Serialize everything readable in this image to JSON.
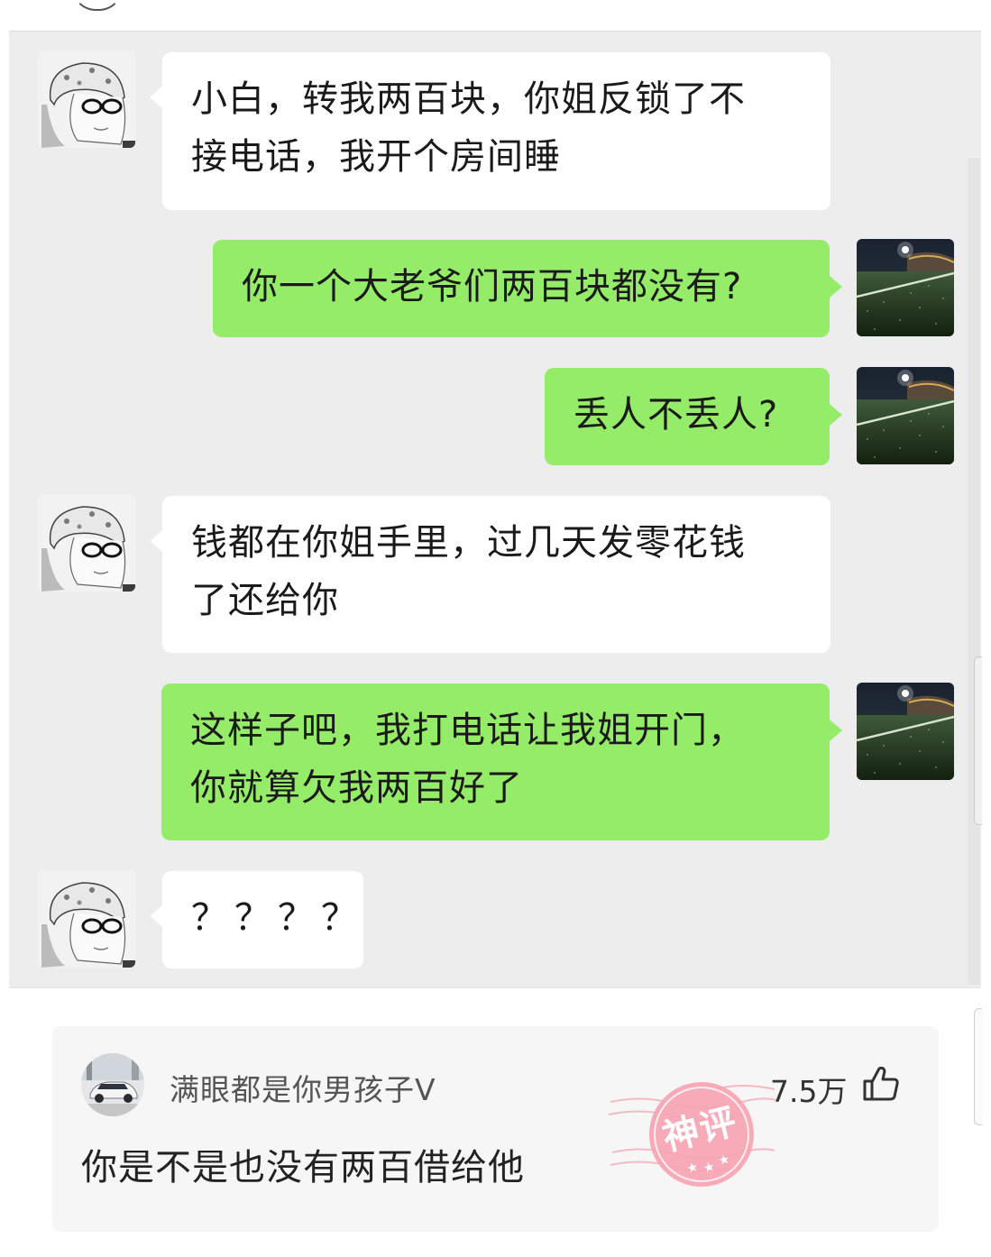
{
  "messages": [
    {
      "side": "left",
      "text": "小白，转我两百块，你姐反锁了不接电话，我开个房间睡",
      "lines": [
        "小白，转我两百块，你姐反锁了不",
        "接电话，我开个房间睡"
      ]
    },
    {
      "side": "right",
      "text": "你一个大老爷们两百块都没有?",
      "lines": [
        "你一个大老爷们两百块都没有?"
      ]
    },
    {
      "side": "right",
      "text": "丢人不丢人?",
      "lines": [
        "丢人不丢人?"
      ]
    },
    {
      "side": "left",
      "text": "钱都在你姐手里，过几天发零花钱了还给你",
      "lines": [
        "钱都在你姐手里，过几天发零花钱",
        "了还给你"
      ]
    },
    {
      "side": "right",
      "text": "这样子吧，我打电话让我姐开门，你就算欠我两百好了",
      "lines": [
        "这样子吧，我打电话让我姐开门，",
        "你就算欠我两百好了"
      ]
    },
    {
      "side": "left",
      "text": "？？？？",
      "lines": [
        "？？？？"
      ]
    }
  ],
  "comment": {
    "username": "满眼都是你男孩子V",
    "likes": "7.5万",
    "text": "你是不是也没有两百借给他",
    "badge": "神评"
  },
  "colors": {
    "chat_background": "#ededed",
    "incoming_bubble": "#ffffff",
    "outgoing_bubble": "#95ec69",
    "comment_card": "#f6f6f6",
    "stamp": "#f08a9c"
  },
  "icons": {
    "incoming_avatar": "sketch-person-avatar-icon",
    "outgoing_avatar": "stadium-night-avatar-icon",
    "like": "thumbs-up-icon",
    "comment_avatar": "car-avatar-icon"
  }
}
